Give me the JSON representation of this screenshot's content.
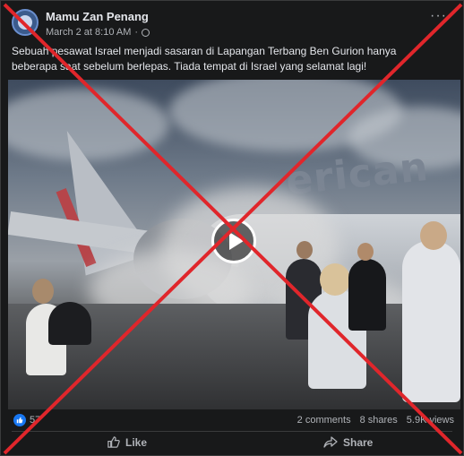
{
  "post": {
    "author": "Mamu Zan Penang",
    "timestamp": "March 2 at 8:10 AM",
    "separator": "·",
    "more_label": "···",
    "caption": "Sebuah pesawat Israel menjadi sasaran di Lapangan Terbang Ben Gurion hanya beberapa saat sebelum berlepas. Tiada tempat di Israel yang selamat lagi!"
  },
  "media": {
    "brand_text": "erican",
    "play_icon": "play-icon"
  },
  "stats": {
    "reaction_count": "57",
    "comments": "2 comments",
    "shares": "8 shares",
    "views": "5.9K views"
  },
  "actions": {
    "like_label": "Like",
    "share_label": "Share"
  },
  "colors": {
    "card_bg": "#18191a",
    "text_primary": "#e4e6eb",
    "text_secondary": "#b0b3b8",
    "like_blue": "#1877f2",
    "false_mark_red": "#e0262b"
  },
  "icons": [
    "avatar",
    "globe-icon",
    "more-options-icon",
    "play-icon",
    "like-reaction-icon",
    "thumbs-up-icon",
    "share-arrow-icon",
    "red-cross-overlay"
  ]
}
